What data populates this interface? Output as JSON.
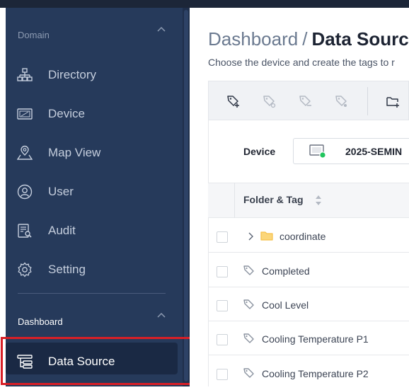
{
  "sidebar": {
    "sections": [
      {
        "title": "Domain",
        "items": [
          {
            "label": "Directory",
            "icon": "sitemap-icon"
          },
          {
            "label": "Device",
            "icon": "monitor-icon"
          },
          {
            "label": "Map View",
            "icon": "map-pin-icon"
          },
          {
            "label": "User",
            "icon": "user-icon"
          },
          {
            "label": "Audit",
            "icon": "audit-icon"
          },
          {
            "label": "Setting",
            "icon": "gear-icon"
          }
        ]
      },
      {
        "title": "Dashboard",
        "items": [
          {
            "label": "Data Source",
            "icon": "data-source-icon",
            "active": true
          }
        ]
      }
    ]
  },
  "breadcrumb": {
    "parent": "Dashboard",
    "separator": "/",
    "current": "Data Source"
  },
  "subtitle": "Choose the device and create the tags to r",
  "toolbar": {
    "icons": [
      "add-tag-icon",
      "tag-icon",
      "tag-icon",
      "tag-icon",
      "add-folder-icon"
    ]
  },
  "device": {
    "label": "Device",
    "value": "2025-SEMIN"
  },
  "table": {
    "header": "Folder & Tag",
    "rows": [
      {
        "type": "folder",
        "label": "coordinate"
      },
      {
        "type": "tag",
        "label": "Completed"
      },
      {
        "type": "tag",
        "label": "Cool Level"
      },
      {
        "type": "tag",
        "label": "Cooling Temperature P1"
      },
      {
        "type": "tag",
        "label": "Cooling Temperature P2"
      }
    ]
  },
  "colors": {
    "sidebar_bg": "#263a5b",
    "highlight": "#d81f26",
    "online": "#22c55e",
    "folder": "#f5c04a"
  }
}
